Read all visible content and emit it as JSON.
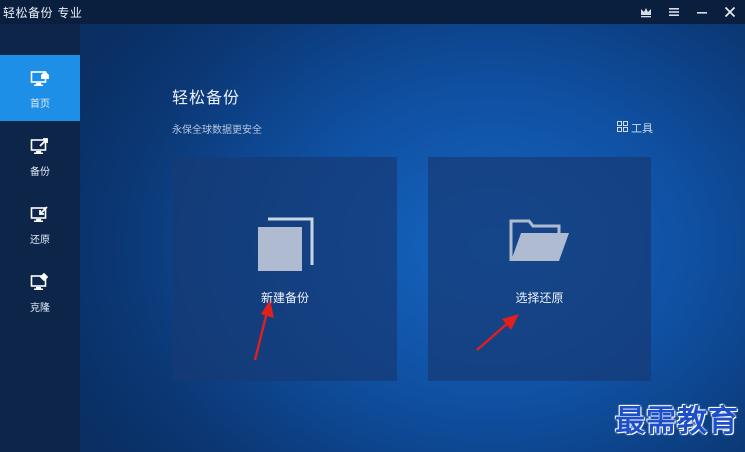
{
  "window": {
    "title": "轻松备份 专业",
    "controls": [
      "crown-icon",
      "menu-icon",
      "minimize-icon",
      "close-icon"
    ]
  },
  "sidebar": {
    "items": [
      {
        "label": "首页",
        "icon": "home-monitor-icon",
        "active": true
      },
      {
        "label": "备份",
        "icon": "backup-monitor-icon",
        "active": false
      },
      {
        "label": "还原",
        "icon": "restore-monitor-icon",
        "active": false
      },
      {
        "label": "克隆",
        "icon": "clone-monitor-icon",
        "active": false
      }
    ]
  },
  "main": {
    "title": "轻松备份",
    "subtitle": "永保全球数据更安全",
    "tools_label": "工具",
    "cards": [
      {
        "label": "新建备份",
        "icon": "copy-stack-icon"
      },
      {
        "label": "选择还原",
        "icon": "open-folder-icon"
      }
    ]
  },
  "watermark": "最需教育",
  "colors": {
    "titlebar": "#0a1e3e",
    "sidebar": "#0c2549",
    "active": "#1d8fe6",
    "main": "#1566c2",
    "annotation_arrow": "#e0201c",
    "watermark": "#1d4fc9"
  }
}
